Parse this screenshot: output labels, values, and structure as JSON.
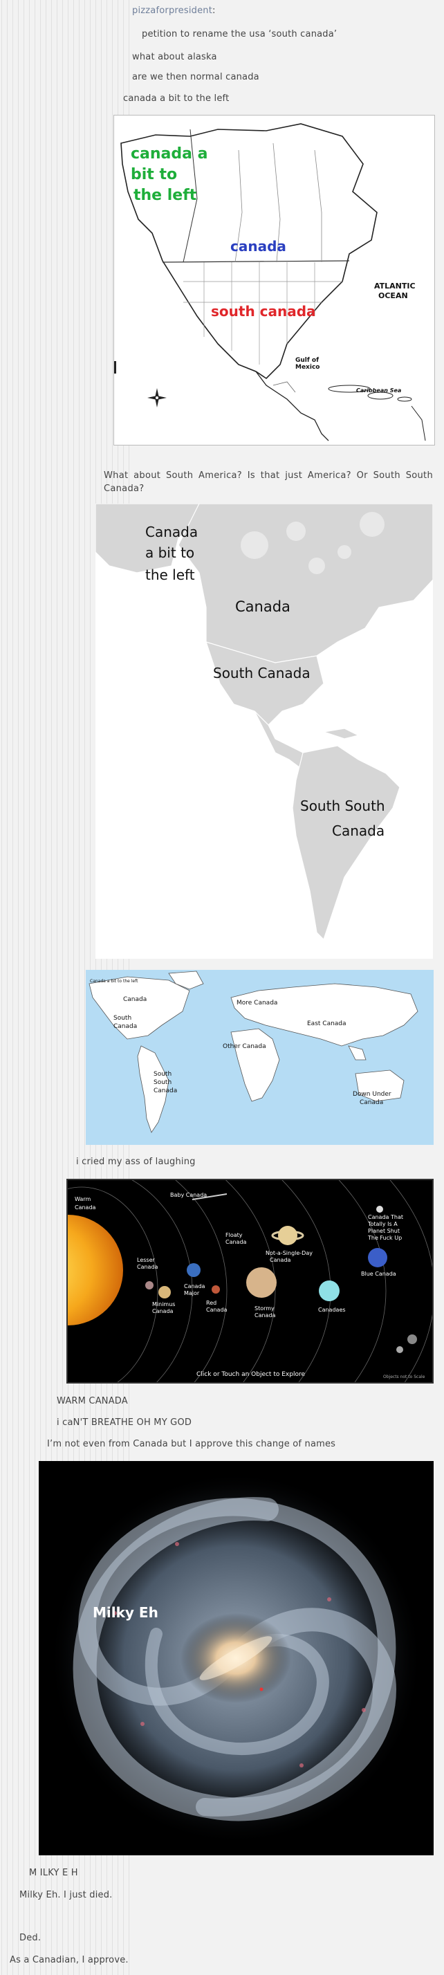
{
  "post": {
    "author": "pizzaforpresident",
    "author_colon": ":",
    "petition": "petition to rename the usa ‘south canada’",
    "alaska": "what about alaska",
    "normal_canada": "are we then normal canada",
    "left_canada": "canada a bit to the left",
    "south_america_q": "What about South America? Is that just America? Or South South Canada?",
    "cried": "i cried my ass of laughing",
    "warm_canada": "WARM CANADA",
    "cant_breathe": "i caN'T BREATHE OH MY GOD",
    "approve_names": "I’m not even from Canada but I approve this change of names",
    "milky_eh_caps": "M ILKY E H",
    "milky_died": "Milky Eh. I just died.",
    "ded": "Ded.",
    "canadian": "As a Canadian, I approve."
  },
  "map1": {
    "label_left_1": "canada a",
    "label_left_2": "bit to",
    "label_left_3": "the left",
    "label_canada": "canada",
    "label_south": "south canada",
    "atlantic_1": "ATLANTIC",
    "atlantic_2": "OCEAN",
    "gulf_1": "Gulf of",
    "gulf_2": "Mexico",
    "caribbean": "Caribbean Sea"
  },
  "map2": {
    "left_1": "Canada",
    "left_2": "a bit to",
    "left_3": "the left",
    "canada": "Canada",
    "south": "South Canada",
    "ssc_1": "South South",
    "ssc_2": "Canada"
  },
  "map3": {
    "left": "Canada a bit to the left",
    "canada": "Canada",
    "south_1": "South",
    "south_2": "Canada",
    "ssc_1": "South",
    "ssc_2": "South",
    "ssc_3": "Canada",
    "more": "More Canada",
    "east": "East Canada",
    "other": "Other Canada",
    "down_1": "Down Under",
    "down_2": "Canada"
  },
  "solar": {
    "warm_1": "Warm",
    "warm_2": "Canada",
    "baby": "Baby Canada",
    "lesser_1": "Lesser",
    "lesser_2": "Canada",
    "minimus_1": "Minimus",
    "minimus_2": "Canada",
    "major_1": "Canada",
    "major_2": "Major",
    "red_1": "Red",
    "red_2": "Canada",
    "floaty_1": "Floaty",
    "floaty_2": "Canada",
    "notso_1": "Not-a-Single-Day",
    "notso_2": "Canada",
    "stormy_1": "Stormy",
    "stormy_2": "Canada",
    "canadaes": "Canadaes",
    "blue": "Blue Canada",
    "totally_1": "Canada That",
    "totally_2": "Totally Is A",
    "totally_3": "Planet Shut",
    "totally_4": "The Fuck Up",
    "click": "Click or Touch an Object to Explore",
    "scale": "Objects not to Scale"
  },
  "galaxy": {
    "label": "Milky Eh"
  },
  "colors": {
    "author": "#6f7f9a",
    "text": "#444444",
    "background": "#f2f2f2",
    "map_green": "#1eae3a",
    "map_blue": "#2a3fc0",
    "map_red": "#e0262a",
    "ocean": "#b5dcf4"
  }
}
